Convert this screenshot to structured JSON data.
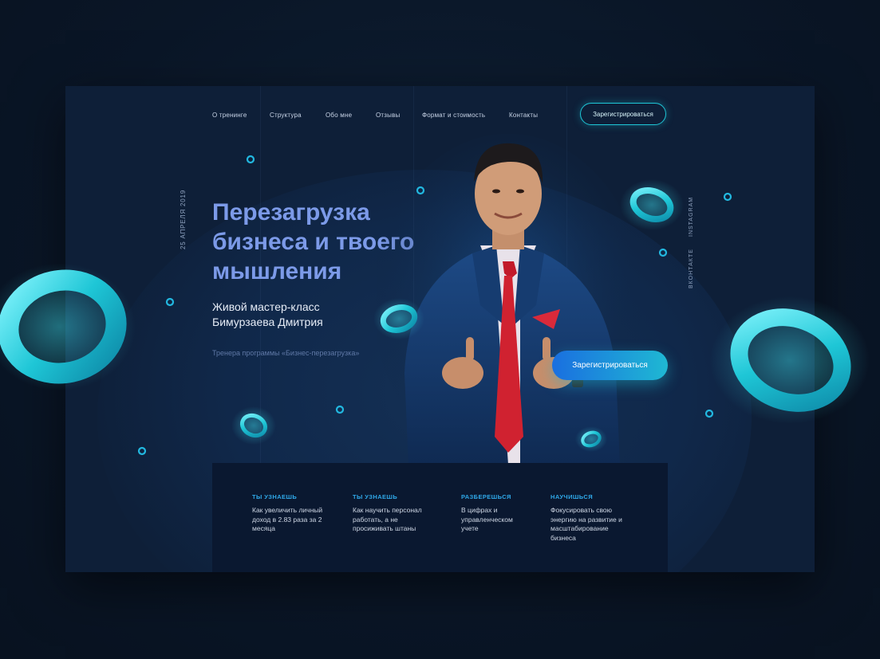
{
  "nav": {
    "items": [
      "О тренинге",
      "Структура",
      "Обо мне",
      "Отзывы",
      "Формат и стоимость",
      "Контакты"
    ],
    "register_label": "Зарегистрироваться"
  },
  "hero": {
    "date": "25 АПРЕЛЯ 2019",
    "title_lines": [
      "Перезагрузка",
      "бизнеса и твоего",
      "мышления"
    ],
    "subtitle_lines": [
      "Живой мастер-класс",
      "Бимурзаева Дмитрия"
    ],
    "note": "Тренера программы «Бизнес-перезагрузка»",
    "cta_label": "Зарегистрироваться"
  },
  "social": [
    "INSTAGRAM",
    "ВКОНТАКТЕ"
  ],
  "features": [
    {
      "tag": "ТЫ УЗНАЕШЬ",
      "lines": [
        "Как увеличить личный",
        "доход в 2.83 раза за 2",
        "месяца"
      ]
    },
    {
      "tag": "ТЫ УЗНАЕШЬ",
      "lines": [
        "Как научить персонал",
        "работать, а не",
        "просиживать штаны"
      ]
    },
    {
      "tag": "РАЗБЕРЕШЬСЯ",
      "lines": [
        "В цифрах и",
        "управленческом",
        "учете"
      ]
    },
    {
      "tag": "НАУЧИШЬСЯ",
      "lines": [
        "Фокусировать свою",
        "энергию на развитие и",
        "масштабирование",
        "бизнеса"
      ]
    }
  ],
  "colors": {
    "background": "#0a1627",
    "frame": "#0e1f38",
    "title": "#7c9ae8",
    "accent": "#1ec6d6",
    "cta_from": "#1a6fe0",
    "cta_to": "#1fb8d3",
    "feature_tag": "#2fa8e8"
  }
}
